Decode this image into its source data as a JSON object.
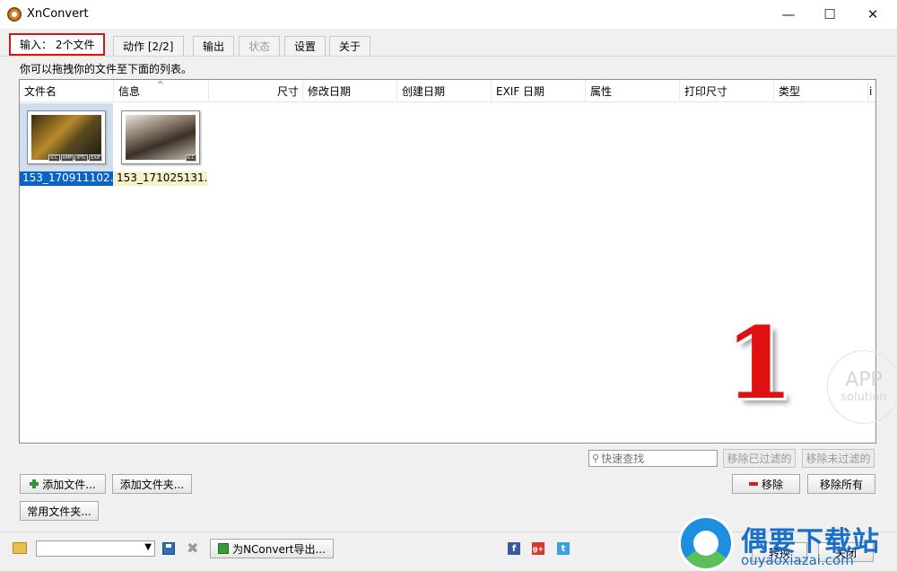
{
  "window": {
    "title": "XnConvert",
    "minimize": "—",
    "maximize": "☐",
    "close": "✕"
  },
  "tabs": [
    {
      "label": "输入： 2个文件",
      "active": true
    },
    {
      "label": "动作 [2/2]"
    },
    {
      "label": "输出"
    },
    {
      "label": "状态",
      "disabled": true
    },
    {
      "label": "设置"
    },
    {
      "label": "关于"
    }
  ],
  "input": {
    "hint": "你可以拖拽你的文件至下面的列表。",
    "columns": [
      "文件名",
      "信息",
      "尺寸",
      "修改日期",
      "创建日期",
      "EXIF 日期",
      "属性",
      "打印尺寸",
      "类型",
      "i"
    ],
    "sort_indicator": "^",
    "files": [
      {
        "name": "153_170911102...",
        "badges": [
          "ICC",
          "XMP",
          "IPTC",
          "EXIF"
        ],
        "selected": true
      },
      {
        "name": "153_171025131...",
        "badges": [
          "ICC"
        ],
        "selected": false
      }
    ],
    "search_placeholder": "快速查找",
    "remove_filtered": "移除已过滤的",
    "remove_unfiltered": "移除未过滤的",
    "add_files": "添加文件...",
    "add_folder": "添加文件夹...",
    "common_folders": "常用文件夹...",
    "remove": "移除",
    "remove_all": "移除所有"
  },
  "overlay": {
    "step_number": "1",
    "app_badge_line1": "APP",
    "app_badge_line2": "solution"
  },
  "bottom": {
    "export_label": "为NConvert导出...",
    "convert": "转换",
    "close": "关闭",
    "facebook": "f",
    "googleplus": "g+",
    "twitter": "t"
  },
  "watermark": {
    "name": "偶要下载站",
    "url": "ouyaoxiazai.com"
  }
}
